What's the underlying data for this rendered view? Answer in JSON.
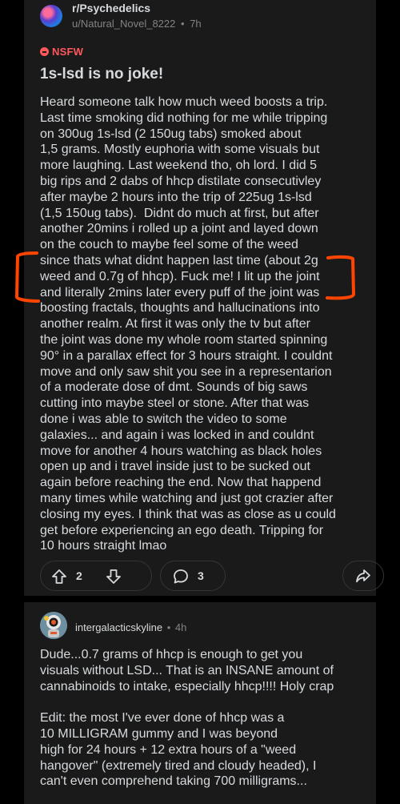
{
  "post": {
    "subreddit": "r/Psychedelics",
    "author": "u/Natural_Novel_8222",
    "separator": "•",
    "age": "7h",
    "nsfw_label": "NSFW",
    "title": "1s-lsd is no joke!",
    "body_lines": [
      "Heard someone talk how much weed boosts a trip.",
      "Last time smoking did nothing for me while tripping",
      "on 300ug 1s-lsd (2 150ug tabs) smoked about",
      "1,5 grams. Mostly euphoria with some visuals but",
      "more laughing. Last weekend tho, oh lord. I did 5",
      "big rips and 2 dabs of hhcp distilate consecutivley",
      "after maybe 2 hours into the trip of 225ug 1s-lsd",
      "(1,5 150ug tabs).  Didnt do much at first, but after",
      "another 20mins i rolled up a joint and layed down",
      "on the couch to maybe feel some of the weed",
      "since thats what didnt happen last time (about 2g",
      "weed and 0.7g of hhcp). Fuck me! I lit up the joint",
      "and literally 2mins later every puff of the joint was",
      "boosting fractals, thoughts and hallucinations into",
      "another realm. At first it was only the tv but after",
      "the joint was done my whole room started spinning",
      "90° in a parallax effect for 3 hours straight. I couldnt",
      "move and only saw shit you see in a representarion",
      "of a moderate dose of dmt. Sounds of big saws",
      "cutting into maybe steel or stone. After that was",
      "done i was able to switch the video to some",
      "galaxies... and again i was locked in and couldnt",
      "move for another 4 hours watching as black holes",
      "open up and i travel inside just to be sucked out",
      "again before reaching the end. Now that happend",
      "many times while watching and just got crazier after",
      "closing my eyes. I think that was as close as u could",
      "get before experiencing an ego death. Tripping for",
      "10 hours straight lmao"
    ],
    "upvotes": "2",
    "comments": "3"
  },
  "comment": {
    "author": "intergalacticskyline",
    "separator": "•",
    "age": "4h",
    "lines": [
      "Dude...0.7 grams of hhcp is enough to get you",
      "visuals without LSD... That is an INSANE amount of",
      "cannabinoids to intake, especially hhcp!!!! Holy crap",
      "",
      "Edit: the most I've ever done of hhcp was a",
      "10 MILLIGRAM gummy and I was beyond",
      "high for 24 hours + 12 extra hours of a \"weed",
      "hangover\" (extremely tired and cloudy headed), I",
      "can't even comprehend taking 700 milligrams..."
    ]
  },
  "colors": {
    "background": "#000000",
    "card": "#1a1a1b",
    "text": "#d7dadc",
    "muted": "#818384",
    "nsfw": "#ff585b",
    "annotation": "#ff4500"
  },
  "icons": {
    "upvote": "arrow-up-icon",
    "downvote": "arrow-down-icon",
    "comment": "speech-bubble-icon",
    "share": "share-arrow-icon",
    "nsfw": "minus-circle-icon"
  }
}
